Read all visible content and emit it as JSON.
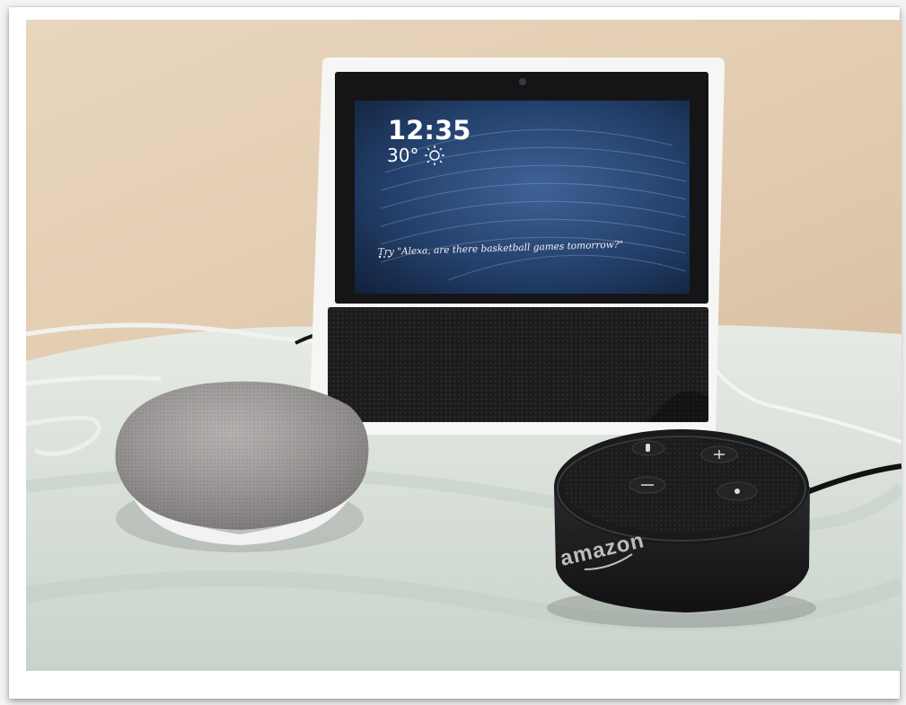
{
  "photo": {
    "description_free": true,
    "screen": {
      "time": "12:35",
      "temperature": "30°",
      "weather_icon": "sun-icon",
      "hint": "Try \"Alexa, are there basketball games tomorrow?\""
    },
    "echo_dot": {
      "brand": "amazon"
    },
    "colors": {
      "wall": "#e4cfb6",
      "blanket": "#d5ddd6",
      "screen_blue": "#2d4d7a",
      "device_black": "#1b1b1d",
      "mini_grey": "#a19c9a"
    }
  }
}
